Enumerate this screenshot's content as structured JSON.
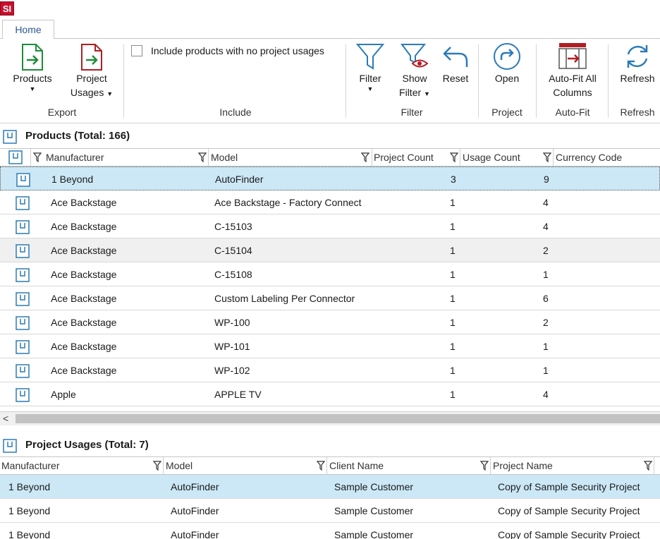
{
  "app": {
    "logo_text": "SI"
  },
  "tabs": [
    {
      "label": "Home"
    }
  ],
  "ribbon": {
    "products_label": "Products",
    "project_usages_line1": "Project",
    "project_usages_line2": "Usages",
    "export_group": "Export",
    "include_checkbox_label": "Include products with no project usages",
    "include_group": "Include",
    "filter_label": "Filter",
    "show_filter_line1": "Show",
    "show_filter_line2": "Filter",
    "reset_label": "Reset",
    "filter_group": "Filter",
    "open_label": "Open",
    "project_group": "Project",
    "autofit_line1": "Auto-Fit All",
    "autofit_line2": "Columns",
    "autofit_group": "Auto-Fit",
    "refresh_label": "Refresh",
    "refresh_group": "Refresh",
    "caret": "▼",
    "colors": {
      "accent": "#2b7bb9",
      "export_green": "#1e8c3a",
      "export_red": "#b01e23"
    }
  },
  "products": {
    "title": "Products (Total: 166)",
    "columns": [
      "Manufacturer",
      "Model",
      "Project Count",
      "Usage Count",
      "Currency Code"
    ],
    "rows": [
      {
        "manufacturer": "1 Beyond",
        "model": "AutoFinder",
        "project_count": "3",
        "usage_count": "9"
      },
      {
        "manufacturer": "Ace Backstage",
        "model": "Ace Backstage - Factory Connect",
        "project_count": "1",
        "usage_count": "4"
      },
      {
        "manufacturer": "Ace Backstage",
        "model": "C-15103",
        "project_count": "1",
        "usage_count": "4"
      },
      {
        "manufacturer": "Ace Backstage",
        "model": "C-15104",
        "project_count": "1",
        "usage_count": "2"
      },
      {
        "manufacturer": "Ace Backstage",
        "model": "C-15108",
        "project_count": "1",
        "usage_count": "1"
      },
      {
        "manufacturer": "Ace Backstage",
        "model": "Custom Labeling Per Connector",
        "project_count": "1",
        "usage_count": "6"
      },
      {
        "manufacturer": "Ace Backstage",
        "model": "WP-100",
        "project_count": "1",
        "usage_count": "2"
      },
      {
        "manufacturer": "Ace Backstage",
        "model": "WP-101",
        "project_count": "1",
        "usage_count": "1"
      },
      {
        "manufacturer": "Ace Backstage",
        "model": "WP-102",
        "project_count": "1",
        "usage_count": "1"
      },
      {
        "manufacturer": "Apple",
        "model": "APPLE TV",
        "project_count": "1",
        "usage_count": "4"
      }
    ]
  },
  "scroll": {
    "left_arrow": "<"
  },
  "usages": {
    "title": "Project Usages (Total: 7)",
    "columns": [
      "Manufacturer",
      "Model",
      "Client Name",
      "Project Name"
    ],
    "rows": [
      {
        "manufacturer": "1 Beyond",
        "model": "AutoFinder",
        "client": "Sample Customer",
        "project": "Copy of Sample Security Project"
      },
      {
        "manufacturer": "1 Beyond",
        "model": "AutoFinder",
        "client": "Sample Customer",
        "project": "Copy of Sample Security Project"
      },
      {
        "manufacturer": "1 Beyond",
        "model": "AutoFinder",
        "client": "Sample Customer",
        "project": "Copy of Sample Security Project"
      }
    ]
  }
}
